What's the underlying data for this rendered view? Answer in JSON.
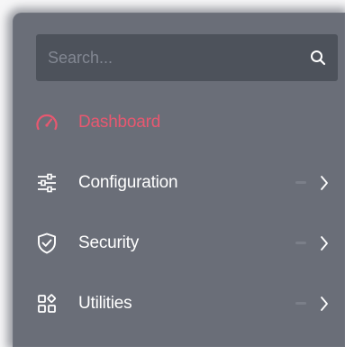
{
  "search": {
    "placeholder": "Search...",
    "value": "",
    "icon": "search-icon"
  },
  "nav": {
    "items": [
      {
        "label": "Dashboard",
        "icon": "speedometer-icon",
        "active": true,
        "expandable": false
      },
      {
        "label": "Configuration",
        "icon": "sliders-icon",
        "active": false,
        "expandable": true
      },
      {
        "label": "Security",
        "icon": "shield-check-icon",
        "active": false,
        "expandable": true
      },
      {
        "label": "Utilities",
        "icon": "apps-grid-icon",
        "active": false,
        "expandable": true
      }
    ]
  },
  "colors": {
    "panel_bg": "#6a6e78",
    "search_bg": "#4d525b",
    "active": "#e85870",
    "text": "#ffffff"
  }
}
